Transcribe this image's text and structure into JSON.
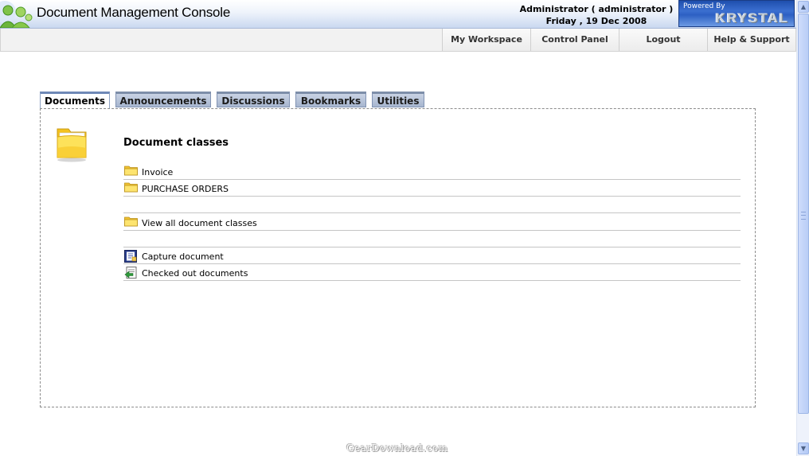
{
  "header": {
    "app_title": "Document Management Console",
    "user_line": "Administrator ( administrator )",
    "date_line": "Friday , 19 Dec 2008",
    "powered_by": "Powered By",
    "brand": "KRYSTAL"
  },
  "nav": {
    "items": [
      {
        "label": "My Workspace"
      },
      {
        "label": "Control Panel"
      },
      {
        "label": "Logout"
      },
      {
        "label": "Help & Support"
      }
    ]
  },
  "tabs": [
    {
      "label": "Documents",
      "active": true
    },
    {
      "label": "Announcements"
    },
    {
      "label": "Discussions"
    },
    {
      "label": "Bookmarks"
    },
    {
      "label": "Utilities"
    }
  ],
  "main": {
    "section_title": "Document classes",
    "classes": [
      {
        "label": "Invoice",
        "icon": "folder-icon"
      },
      {
        "label": "PURCHASE ORDERS",
        "icon": "folder-icon"
      }
    ],
    "view_all": {
      "label": "View all document classes",
      "icon": "folder-icon"
    },
    "actions": [
      {
        "label": "Capture document",
        "icon": "capture-document-icon"
      },
      {
        "label": "Checked out documents",
        "icon": "checked-out-icon"
      }
    ]
  },
  "watermark": "GearDownload.com",
  "colors": {
    "header_gradient_end": "#c9d8f0",
    "tab_inactive": "#a7b6cf",
    "panel_border": "#8c8c8c",
    "folder_yellow": "#f8cf2e"
  }
}
